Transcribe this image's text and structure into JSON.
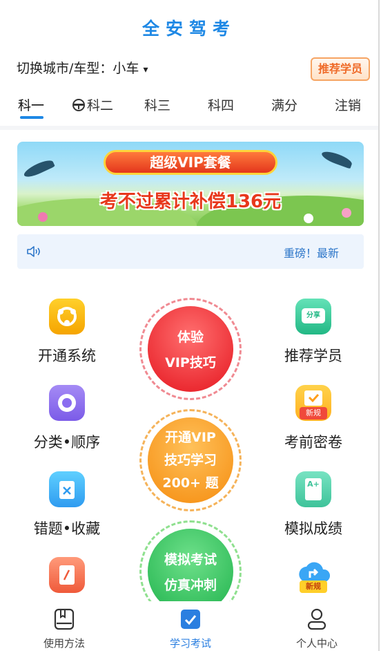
{
  "app": {
    "title": "全安驾考"
  },
  "city": {
    "prefix": "切换城市/车型：",
    "value": "小车",
    "caret": "▾"
  },
  "recommend_button": "推荐学员",
  "tabs": [
    {
      "label": "科一"
    },
    {
      "label": "科二"
    },
    {
      "label": "科三"
    },
    {
      "label": "科四"
    },
    {
      "label": "满分"
    },
    {
      "label": "注销"
    }
  ],
  "banner": {
    "pill": "超级VIP套餐",
    "headline": "考不过累计补偿136元"
  },
  "notice": {
    "text": "重磅！最新",
    "icon": "speaker-icon"
  },
  "left_items": [
    {
      "label": "开通系统",
      "icon": "share-network-icon"
    },
    {
      "label": "分类•顺序",
      "icon": "radio-circle-icon"
    },
    {
      "label": "错题•收藏",
      "icon": "error-book-icon"
    },
    {
      "label": "",
      "icon": "notebook-icon"
    }
  ],
  "right_items": [
    {
      "label": "推荐学员",
      "icon": "share-badge-icon",
      "badge": "分享"
    },
    {
      "label": "考前密卷",
      "icon": "calendar-icon",
      "badge": "新规"
    },
    {
      "label": "模拟成绩",
      "icon": "grade-sheet-icon",
      "badge": "A+"
    },
    {
      "label": "",
      "icon": "cloud-share-icon",
      "badge": "新规"
    }
  ],
  "circles": [
    {
      "line1": "体验",
      "line2": "VIP技巧",
      "line3": ""
    },
    {
      "line1": "开通VIP",
      "line2": "技巧学习",
      "line3": "200+ 题"
    },
    {
      "line1": "模拟考试",
      "line2": "仿真冲刺",
      "line3": ""
    }
  ],
  "tabbar": [
    {
      "label": "使用方法",
      "icon": "book-icon"
    },
    {
      "label": "学习考试",
      "icon": "check-task-icon"
    },
    {
      "label": "个人中心",
      "icon": "user-icon"
    }
  ],
  "colors": {
    "accent": "#1e88e5",
    "red_circle": "#e8262c",
    "orange_circle": "#f79a1c",
    "green_circle": "#2ec55c"
  }
}
